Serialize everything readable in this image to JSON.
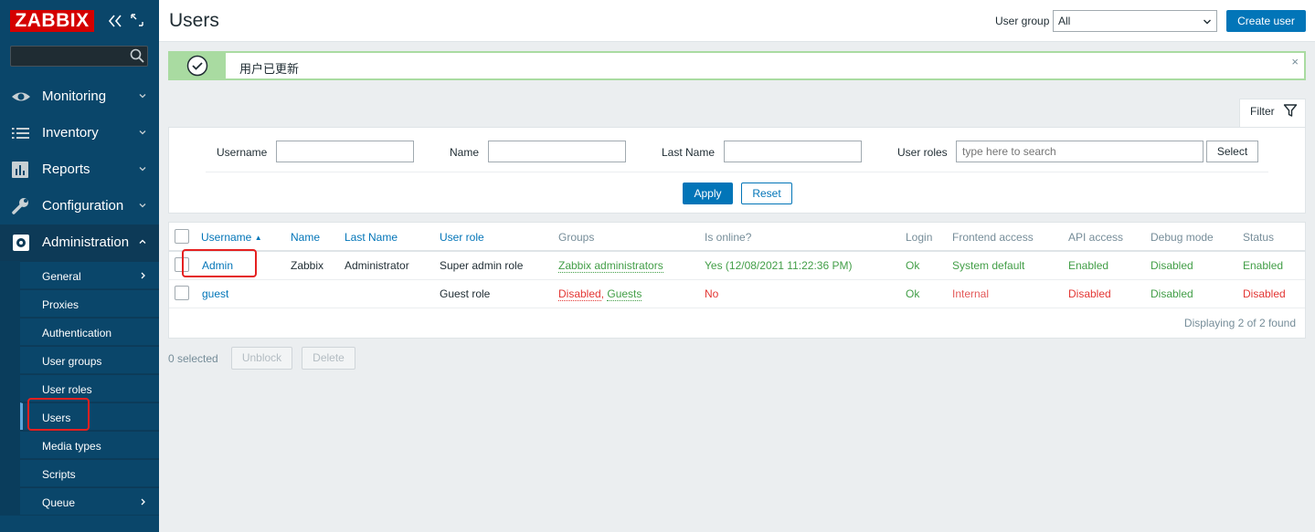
{
  "sidebar": {
    "logo": "ZABBIX",
    "search_placeholder": "",
    "menu": [
      {
        "label": "Monitoring"
      },
      {
        "label": "Inventory"
      },
      {
        "label": "Reports"
      },
      {
        "label": "Configuration"
      },
      {
        "label": "Administration"
      }
    ],
    "submenu": [
      {
        "label": "General"
      },
      {
        "label": "Proxies"
      },
      {
        "label": "Authentication"
      },
      {
        "label": "User groups"
      },
      {
        "label": "User roles"
      },
      {
        "label": "Users"
      },
      {
        "label": "Media types"
      },
      {
        "label": "Scripts"
      },
      {
        "label": "Queue"
      }
    ]
  },
  "header": {
    "title": "Users",
    "user_group_label": "User group",
    "user_group_value": "All",
    "create_label": "Create user"
  },
  "message": {
    "text": "用户已更新",
    "close": "×"
  },
  "filter": {
    "tab_label": "Filter",
    "username_label": "Username",
    "name_label": "Name",
    "lastname_label": "Last Name",
    "roles_label": "User roles",
    "roles_placeholder": "type here to search",
    "select_label": "Select",
    "apply_label": "Apply",
    "reset_label": "Reset"
  },
  "table": {
    "headers": {
      "username": "Username",
      "sort_arrow": "▲",
      "name": "Name",
      "lastname": "Last Name",
      "role": "User role",
      "groups": "Groups",
      "online": "Is online?",
      "login": "Login",
      "frontend": "Frontend access",
      "api": "API access",
      "debug": "Debug mode",
      "status": "Status"
    },
    "rows": [
      {
        "username": "Admin",
        "name": "Zabbix",
        "lastname": "Administrator",
        "role": "Super admin role",
        "group1": "Zabbix administrators",
        "online": "Yes (12/08/2021 11:22:36 PM)",
        "login": "Ok",
        "frontend": "System default",
        "api": "Enabled",
        "debug": "Disabled",
        "status": "Enabled"
      },
      {
        "username": "guest",
        "name": "",
        "lastname": "",
        "role": "Guest role",
        "group1": "Disabled",
        "group_sep": ", ",
        "group2": "Guests",
        "online": "No",
        "login": "Ok",
        "frontend": "Internal",
        "api": "Disabled",
        "debug": "Disabled",
        "status": "Disabled"
      }
    ],
    "footer": "Displaying 2 of 2 found"
  },
  "actions": {
    "selected": "0 selected",
    "unblock": "Unblock",
    "delete": "Delete"
  },
  "colors": {
    "sidebar": "#0a466a",
    "primary": "#0275b8",
    "success": "#429e47",
    "danger": "#e33734",
    "logo": "#d40000",
    "annotation": "#e52020"
  }
}
